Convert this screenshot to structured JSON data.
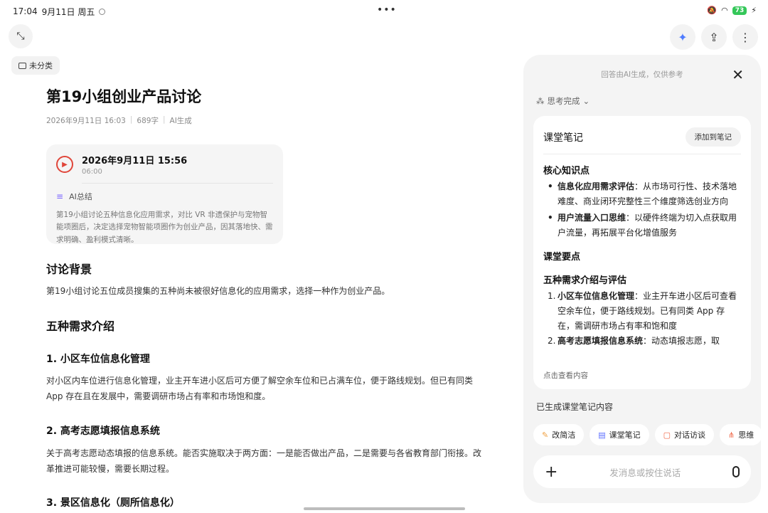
{
  "status": {
    "time": "17:04",
    "date": "9月11日 周五",
    "battery": "73"
  },
  "category": "未分类",
  "doc": {
    "title": "第19小组创业产品讨论",
    "meta_date": "2026年9月11日 16:03",
    "meta_words": "689字",
    "meta_source": "AI生成",
    "record": {
      "datetime": "2026年9月11日 15:56",
      "duration": "06:00",
      "ai_summary_label": "AI总结",
      "ai_summary_text": "第19小组讨论五种信息化应用需求，对比 VR 非遗保护与宠物智能项圈后，决定选择宠物智能项圈作为创业产品，因其落地快、需求明确、盈利模式清晰。"
    },
    "bg_heading": "讨论背景",
    "bg_text": "第19小组讨论五位成员搜集的五种尚未被很好信息化的应用需求，选择一种作为创业产品。",
    "five_heading": "五种需求介绍",
    "item1_heading": "1. 小区车位信息化管理",
    "item1_text": "对小区内车位进行信息化管理，业主开车进小区后可方便了解空余车位和已占满车位，便于路线规划。但已有同类 App 存在且在发展中，需要调研市场占有率和市场饱和度。",
    "item2_heading": "2. 高考志愿填报信息系统",
    "item2_text": "关于高考志愿动态填报的信息系统。能否实施取决于两方面：一是能否做出产品，二是需要与各省教育部门衔接。改革推进可能较慢，需要长期过程。",
    "item3_heading": "3. 景区信息化（厕所信息化）"
  },
  "panel": {
    "disclaimer": "回答由AI生成，仅供参考",
    "thinking": "思考完成",
    "note_title": "课堂笔记",
    "add_button": "添加到笔记",
    "core_heading": "核心知识点",
    "core_points": [
      {
        "bold": "信息化应用需求评估",
        "text": "：从市场可行性、技术落地难度、商业闭环完整性三个维度筛选创业方向"
      },
      {
        "bold": "用户流量入口思维",
        "text": "：以硬件终端为切入点获取用户流量，再拓展平台化增值服务"
      }
    ],
    "key_heading": "课堂要点",
    "five_heading": "五种需求介绍与评估",
    "five_items": [
      {
        "num": "1.",
        "bold": "小区车位信息化管理",
        "text": "：业主开车进小区后可查看空余车位，便于路线规划。已有同类 App 存在，需调研市场占有率和饱和度"
      },
      {
        "num": "2.",
        "bold": "高考志愿填报信息系统",
        "text": "：动态填报志愿，取"
      }
    ],
    "view_more": "点击查看内容",
    "generated": "已生成课堂笔记内容",
    "chips": [
      "改简洁",
      "课堂笔记",
      "对话访谈",
      "思维"
    ],
    "input_placeholder": "发消息或按住说话"
  }
}
